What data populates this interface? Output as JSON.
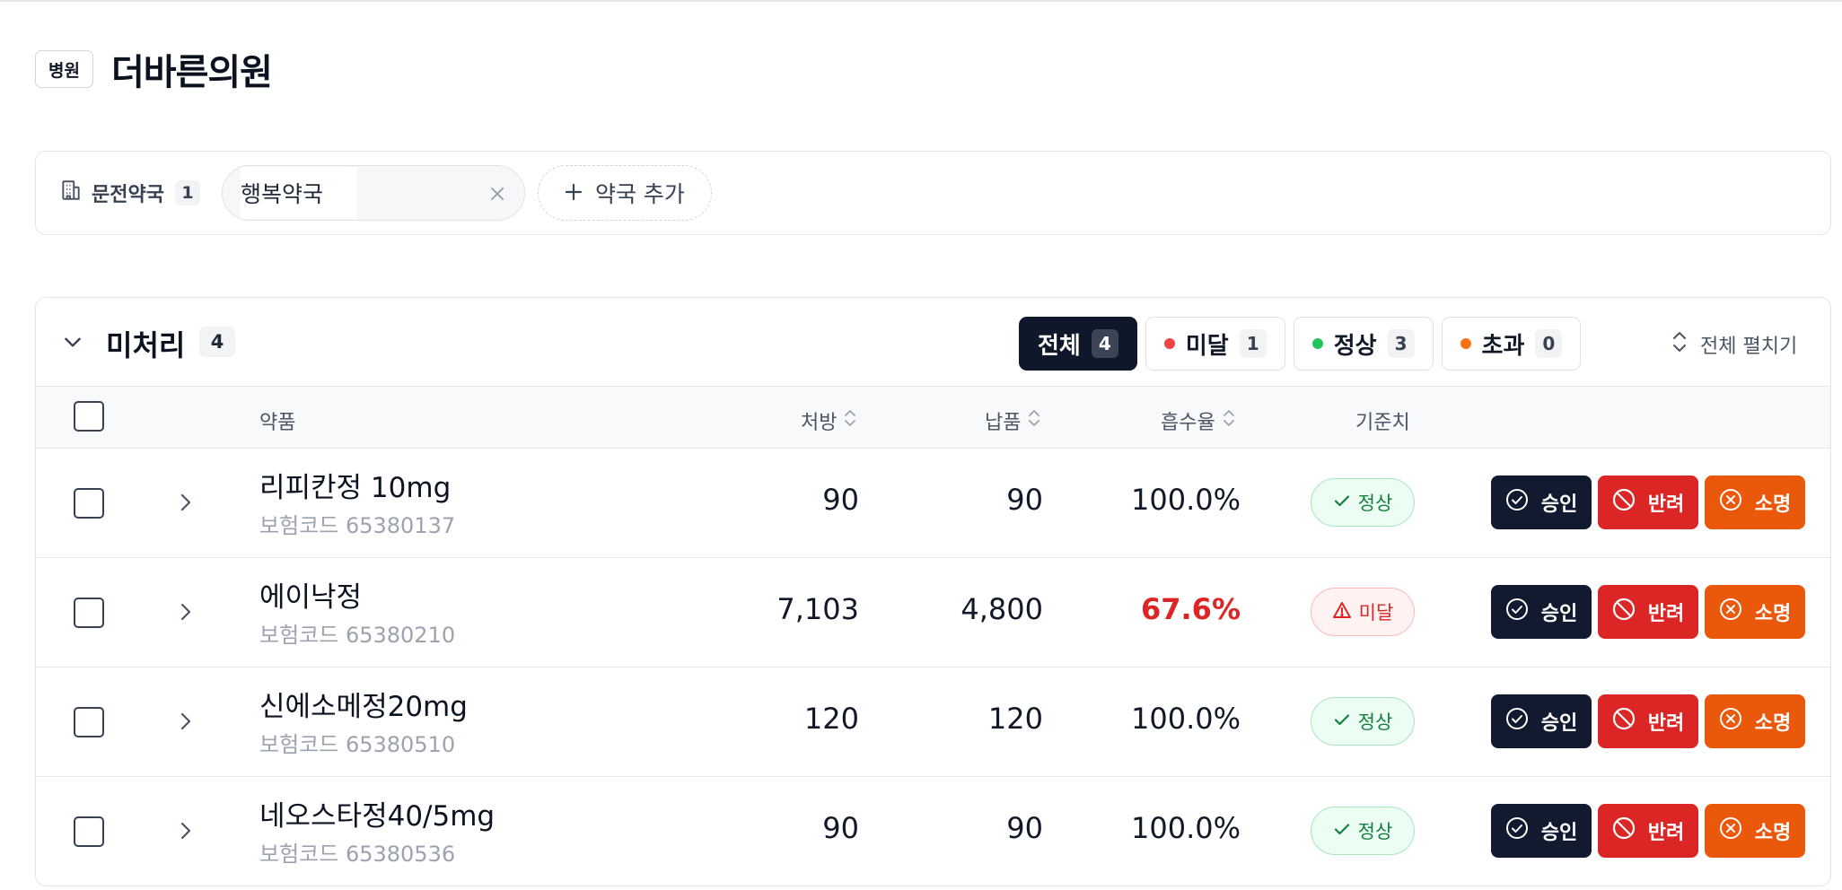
{
  "header": {
    "badge": "병원",
    "title": "더바른의원"
  },
  "pharmacies": {
    "label": "문전약국",
    "count": "1",
    "tags": [
      "행복약국"
    ],
    "add_label": "약국 추가"
  },
  "section": {
    "title": "미처리",
    "count": "4",
    "filters": [
      {
        "label": "전체",
        "count": "4",
        "active": true
      },
      {
        "label": "미달",
        "count": "1",
        "dot_color": "#ef4444"
      },
      {
        "label": "정상",
        "count": "3",
        "dot_color": "#22c55e"
      },
      {
        "label": "초과",
        "count": "0",
        "dot_color": "#f97316"
      }
    ],
    "expand_all": "전체 펼치기"
  },
  "table": {
    "columns": {
      "drug": "약품",
      "prescribed": "처방",
      "delivered": "납품",
      "rate": "흡수율",
      "threshold": "기준치"
    },
    "rows": [
      {
        "name": "리피칸정 10mg",
        "code": "보험코드 65380137",
        "prescribed": "90",
        "delivered": "90",
        "rate": "100.0%",
        "status": "정상"
      },
      {
        "name": "에이낙정",
        "code": "보험코드 65380210",
        "prescribed": "7,103",
        "delivered": "4,800",
        "rate": "67.6%",
        "status": "미달"
      },
      {
        "name": "신에소메정20mg",
        "code": "보험코드 65380510",
        "prescribed": "120",
        "delivered": "120",
        "rate": "100.0%",
        "status": "정상"
      },
      {
        "name": "네오스타정40/5mg",
        "code": "보험코드 65380536",
        "prescribed": "90",
        "delivered": "90",
        "rate": "100.0%",
        "status": "정상"
      }
    ],
    "actions": {
      "approve": "승인",
      "reject": "반려",
      "consume": "소명"
    }
  },
  "colors": {
    "primary_dark": "#111a2e",
    "danger": "#dc2626",
    "warning": "#ea580c",
    "success": "#15803d"
  }
}
